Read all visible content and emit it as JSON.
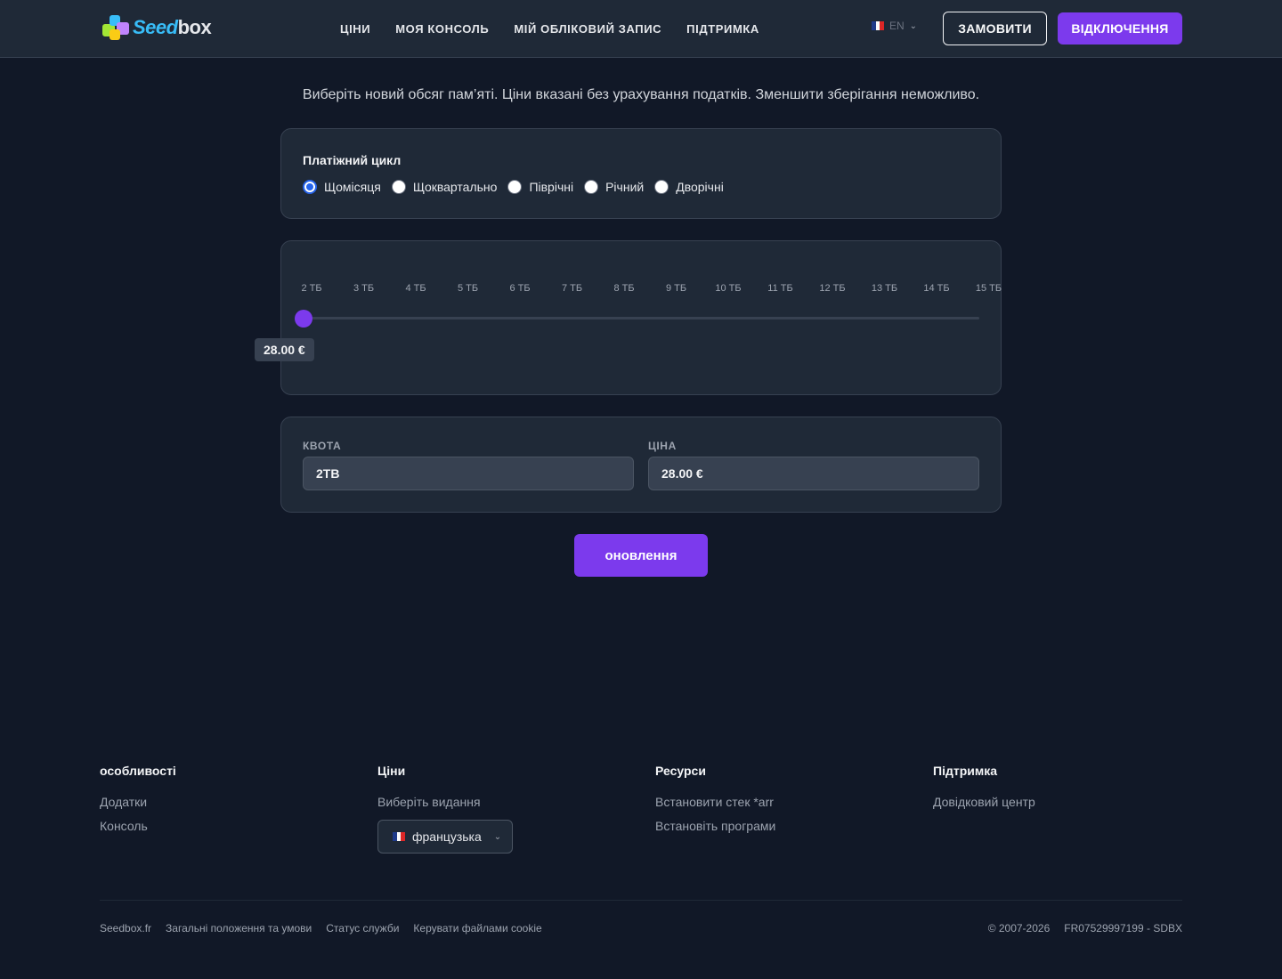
{
  "header": {
    "logo_part1": "Seed",
    "logo_part2": "box",
    "nav": [
      "ЦІНИ",
      "МОЯ КОНСОЛЬ",
      "МІЙ ОБЛІКОВИЙ ЗАПИС",
      "ПІДТРИМКА"
    ],
    "lang_code": "EN",
    "order_label": "ЗАМОВИТИ",
    "logout_label": "ВІДКЛЮЧЕННЯ"
  },
  "intro": "Виберіть новий обсяг пам’яті. Ціни вказані без урахування податків. Зменшити зберігання неможливо.",
  "billing": {
    "title": "Платіжний цикл",
    "options": [
      "Щомісяця",
      "Щоквартально",
      "Піврічні",
      "Річний",
      "Дворічні"
    ],
    "selected": "Щомісяця"
  },
  "slider": {
    "ticks": [
      "2 ТБ",
      "3 ТБ",
      "4 ТБ",
      "5 ТБ",
      "6 ТБ",
      "7 ТБ",
      "8 ТБ",
      "9 ТБ",
      "10 ТБ",
      "11 ТБ",
      "12 ТБ",
      "13 ТБ",
      "14 ТБ",
      "15 ТБ"
    ],
    "value_index": 0,
    "price_label": "28.00 €"
  },
  "summary": {
    "quota_label": "КВОТА",
    "quota_value": "2TB",
    "price_label": "ЦІНА",
    "price_value": "28.00 €"
  },
  "update_label": "оновлення",
  "footer": {
    "col1": {
      "title": "особливості",
      "links": [
        "Додатки",
        "Консоль"
      ]
    },
    "col2": {
      "title": "Ціни",
      "links": [
        "Виберіть видання"
      ],
      "language": "французька"
    },
    "col3": {
      "title": "Ресурси",
      "links": [
        "Встановити стек *arr",
        "Встановіть програми"
      ]
    },
    "col4": {
      "title": "Підтримка",
      "links": [
        "Довідковий центр"
      ]
    },
    "bottom_links": [
      "Seedbox.fr",
      "Загальні положення та умови",
      "Статус служби",
      "Керувати файлами cookie"
    ],
    "copyright": "© 2007-2026",
    "company_id": "FR07529997199 - SDBX"
  },
  "colors": {
    "accent": "#7c3aed",
    "background": "#111827",
    "card": "#1f2937",
    "radio_checked": "#2563eb"
  }
}
